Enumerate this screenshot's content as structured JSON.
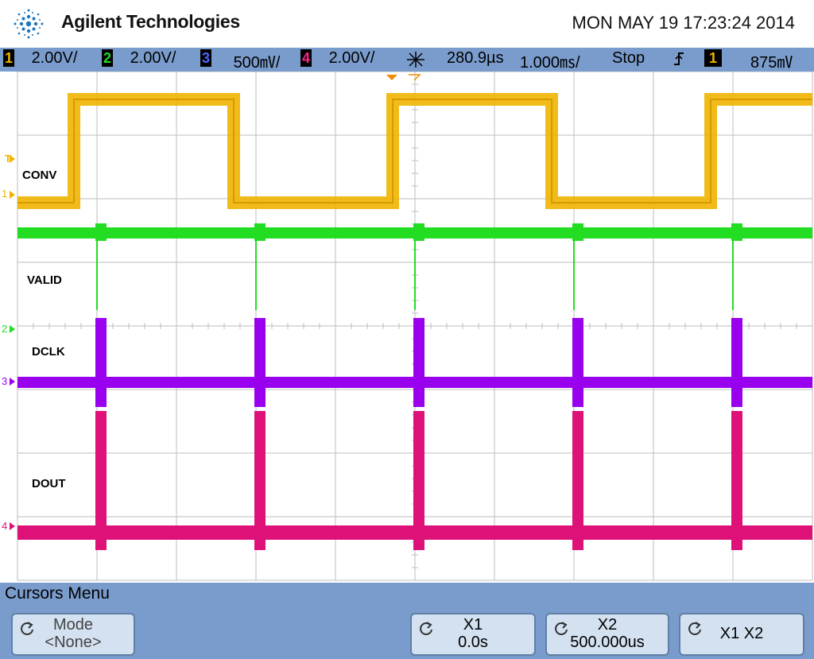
{
  "header": {
    "brand": "Agilent Technologies",
    "datetime": "MON MAY 19 17:23:24 2014"
  },
  "status": {
    "ch1_scale": "2.00V/",
    "ch2_scale": "2.00V/",
    "ch3_scale": "500㎷/",
    "ch4_scale": "2.00V/",
    "delay": "280.9µs",
    "timebase": "1.000㎳/",
    "run_state": "Stop",
    "trigger_level": "875㎷",
    "ch1": "1",
    "ch2": "2",
    "ch3": "3",
    "ch4": "4",
    "trig_ch": "1"
  },
  "traces": {
    "ch1_label": "CONV",
    "ch2_label": "VALID",
    "ch3_label": "DCLK",
    "ch4_label": "DOUT",
    "ch1_marker": "1",
    "ch2_marker": "2",
    "ch3_marker": "3",
    "ch4_marker": "4",
    "trig_marker": "T"
  },
  "colors": {
    "ch1": "#f0b400",
    "ch2": "#22dd22",
    "ch3": "#9900ee",
    "ch4": "#dd1177",
    "panel": "#7a9ccc"
  },
  "menu": {
    "title": "Cursors Menu",
    "mode_label": "Mode",
    "mode_value": "<None>",
    "x1_label": "X1",
    "x1_value": "0.0s",
    "x2_label": "X2",
    "x2_value": "500.000us",
    "x1x2_label": "X1 X2"
  }
}
